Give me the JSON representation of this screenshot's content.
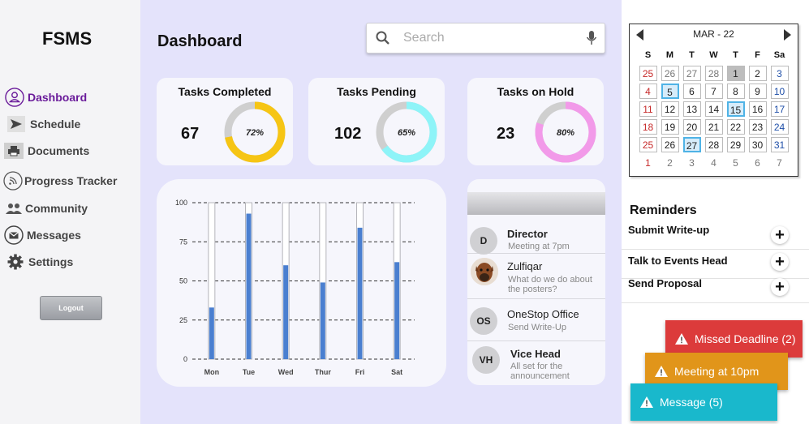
{
  "app": {
    "brand": "FSMS"
  },
  "nav": {
    "items": [
      {
        "label": "Dashboard",
        "icon": "user-icon"
      },
      {
        "label": "Schedule",
        "icon": "send-icon"
      },
      {
        "label": "Documents",
        "icon": "printer-icon"
      },
      {
        "label": "Progress Tracker",
        "icon": "rss-icon"
      },
      {
        "label": "Community",
        "icon": "people-icon"
      },
      {
        "label": "Messages",
        "icon": "mail-icon"
      },
      {
        "label": "Settings",
        "icon": "gear-icon"
      }
    ],
    "logout": "Logout"
  },
  "header": {
    "title": "Dashboard"
  },
  "search": {
    "placeholder": "Search",
    "value": ""
  },
  "stats": [
    {
      "label": "Tasks Completed",
      "value": "67",
      "percent_label": "72%",
      "percent": 72,
      "color": "#f6c514"
    },
    {
      "label": "Tasks Pending",
      "value": "102",
      "percent_label": "65%",
      "percent": 65,
      "color": "#8ef4f8"
    },
    {
      "label": "Tasks on Hold",
      "value": "23",
      "percent_label": "80%",
      "percent": 80,
      "color": "#f29ae9"
    }
  ],
  "chart_data": {
    "type": "bar",
    "categories": [
      "Mon",
      "Tue",
      "Wed",
      "Thur",
      "Fri",
      "Sat"
    ],
    "values": [
      33,
      93,
      60,
      49,
      84,
      62
    ],
    "yticks": [
      "0",
      "25",
      "50",
      "75",
      "100"
    ],
    "ylim": [
      0,
      100
    ],
    "bar_color": "#4a7fd0",
    "track_color": "#ffffff",
    "grid": "dashed"
  },
  "messages": [
    {
      "name": "Director",
      "text": "Meeting at 7pm",
      "avatar": "D"
    },
    {
      "name": "Zulfiqar",
      "text": "What do we do about the posters?",
      "avatar": "dog-photo"
    },
    {
      "name": "OneStop Office",
      "text": "Send Write-Up",
      "avatar": "OS"
    },
    {
      "name": "Vice Head",
      "text": "All set for the announcement",
      "avatar": "VH"
    }
  ],
  "calendar": {
    "month": "MAR - 22",
    "weekdays": [
      "S",
      "M",
      "T",
      "W",
      "T",
      "F",
      "Sa"
    ],
    "days": [
      {
        "d": "25",
        "t": "red-muted"
      },
      {
        "d": "26",
        "t": "muted"
      },
      {
        "d": "27",
        "t": "muted"
      },
      {
        "d": "28",
        "t": "muted"
      },
      {
        "d": "1",
        "t": "today"
      },
      {
        "d": "2",
        "t": ""
      },
      {
        "d": "3",
        "t": "blue"
      },
      {
        "d": "4",
        "t": "red"
      },
      {
        "d": "5",
        "t": "marked"
      },
      {
        "d": "6",
        "t": ""
      },
      {
        "d": "7",
        "t": ""
      },
      {
        "d": "8",
        "t": ""
      },
      {
        "d": "9",
        "t": ""
      },
      {
        "d": "10",
        "t": "blue"
      },
      {
        "d": "11",
        "t": "red"
      },
      {
        "d": "12",
        "t": ""
      },
      {
        "d": "13",
        "t": ""
      },
      {
        "d": "14",
        "t": ""
      },
      {
        "d": "15",
        "t": "marked"
      },
      {
        "d": "16",
        "t": ""
      },
      {
        "d": "17",
        "t": "blue"
      },
      {
        "d": "18",
        "t": "red"
      },
      {
        "d": "19",
        "t": ""
      },
      {
        "d": "20",
        "t": ""
      },
      {
        "d": "21",
        "t": ""
      },
      {
        "d": "22",
        "t": ""
      },
      {
        "d": "23",
        "t": ""
      },
      {
        "d": "24",
        "t": "blue"
      },
      {
        "d": "25",
        "t": "red"
      },
      {
        "d": "26",
        "t": ""
      },
      {
        "d": "27",
        "t": "marked"
      },
      {
        "d": "28",
        "t": ""
      },
      {
        "d": "29",
        "t": ""
      },
      {
        "d": "30",
        "t": ""
      },
      {
        "d": "31",
        "t": "blue"
      },
      {
        "d": "1",
        "t": "red-plain"
      },
      {
        "d": "2",
        "t": "plain"
      },
      {
        "d": "3",
        "t": "plain"
      },
      {
        "d": "4",
        "t": "plain"
      },
      {
        "d": "5",
        "t": "plain"
      },
      {
        "d": "6",
        "t": "plain"
      },
      {
        "d": "7",
        "t": "plain"
      }
    ]
  },
  "reminders": {
    "title": "Reminders",
    "items": [
      "Submit Write-up",
      "Talk to Events Head",
      "Send Proposal"
    ],
    "add_symbol": "+"
  },
  "notifications": [
    {
      "label": "Missed Deadline (2)",
      "color": "#dc3b3b"
    },
    {
      "label": "Meeting at 10pm",
      "color": "#e1951a"
    },
    {
      "label": "Message (5)",
      "color": "#19b8cc"
    }
  ]
}
